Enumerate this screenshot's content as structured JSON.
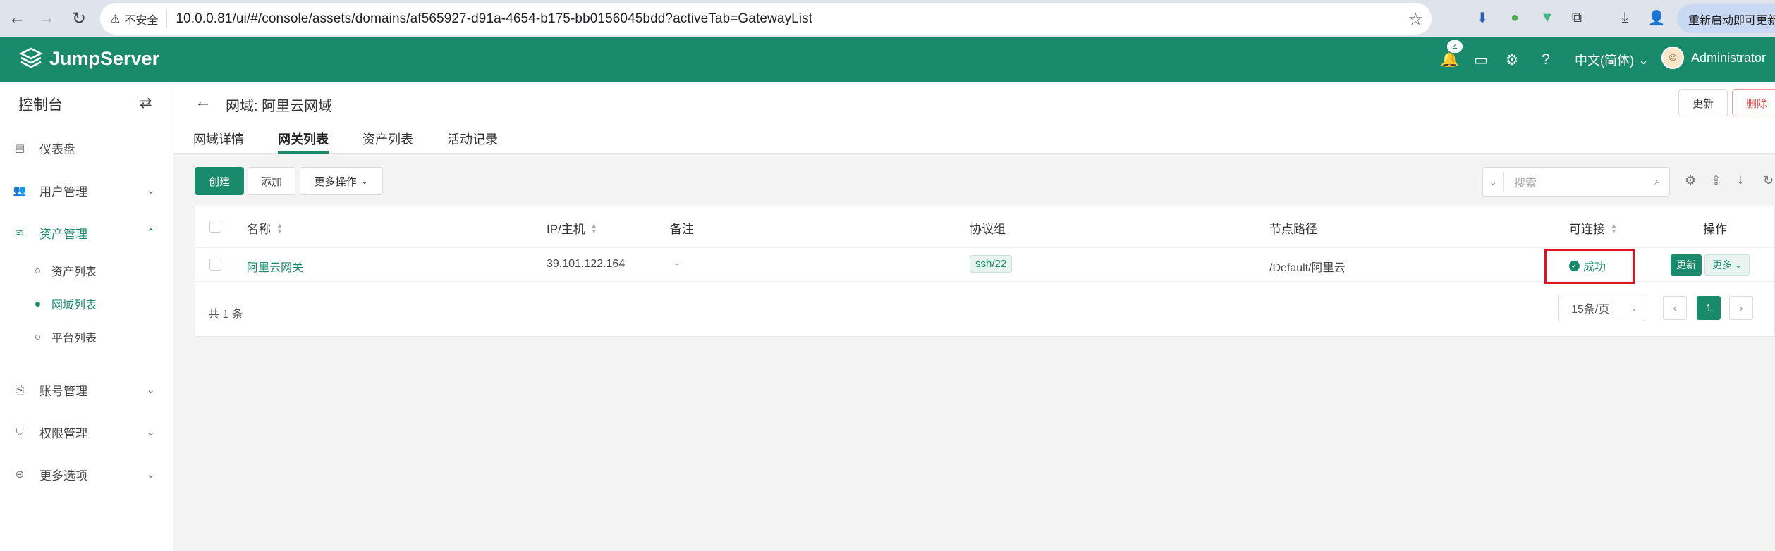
{
  "browser": {
    "insecure_label": "不安全",
    "url": "10.0.0.81/ui/#/console/assets/domains/af565927-d91a-4654-b175-bb0156045bdd?activeTab=GatewayList",
    "update_label": "重新启动即可更新"
  },
  "header": {
    "logo": "JumpServer",
    "notification_count": "4",
    "language": "中文(简体)",
    "user": "Administrator"
  },
  "sidebar": {
    "title": "控制台",
    "items": [
      {
        "label": "仪表盘",
        "icon": "dashboard-icon"
      },
      {
        "label": "用户管理",
        "icon": "users-icon"
      },
      {
        "label": "资产管理",
        "icon": "layers-icon"
      },
      {
        "label": "账号管理",
        "icon": "accounts-icon"
      },
      {
        "label": "权限管理",
        "icon": "shield-icon"
      },
      {
        "label": "更多选项",
        "icon": "more-icon"
      }
    ],
    "sub_items": [
      {
        "label": "资产列表"
      },
      {
        "label": "网域列表"
      },
      {
        "label": "平台列表"
      }
    ]
  },
  "page": {
    "title": "网域: 阿里云网域",
    "tabs": [
      "网域详情",
      "网关列表",
      "资产列表",
      "活动记录"
    ],
    "update_button": "更新",
    "delete_button": "删除"
  },
  "toolbar": {
    "create": "创建",
    "add": "添加",
    "more_actions": "更多操作",
    "search_placeholder": "搜索"
  },
  "table": {
    "columns": {
      "name": "名称",
      "ip": "IP/主机",
      "comment": "备注",
      "protocols": "协议组",
      "node_path": "节点路径",
      "connectivity": "可连接",
      "actions": "操作"
    },
    "rows": [
      {
        "name": "阿里云网关",
        "ip": "39.101.122.164",
        "comment": "-",
        "protocol": "ssh/22",
        "node_path": "/Default/阿里云",
        "status": "成功",
        "action_update": "更新",
        "action_more": "更多"
      }
    ],
    "total": "共 1 条",
    "page_size": "15条/页",
    "current_page": "1"
  }
}
